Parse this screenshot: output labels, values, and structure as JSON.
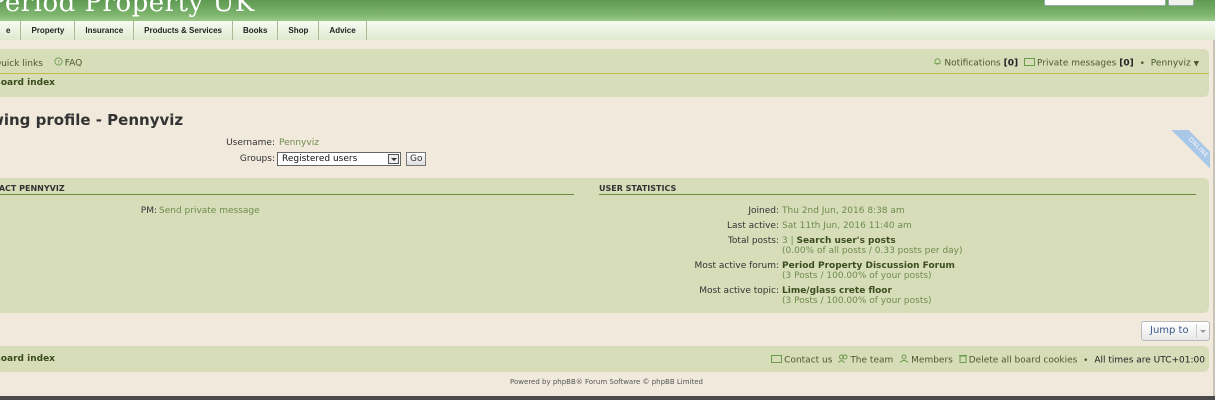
{
  "site": {
    "title": "Period Property UK"
  },
  "nav": [
    "e",
    "Property",
    "Insurance",
    "Products & Services",
    "Books",
    "Shop",
    "Advice"
  ],
  "quick_links": {
    "quick_links": "Quick links",
    "faq": "FAQ"
  },
  "user_bar": {
    "notifications_label": "Notifications",
    "notifications_count": "[0]",
    "pm_label": "Private messages",
    "pm_count": "[0]",
    "bullet": "•",
    "username": "Pennyviz"
  },
  "breadcrumb": "Board index",
  "page_title": "wing profile - Pennyviz",
  "profile": {
    "username_label": "Username:",
    "username_value": "Pennyviz",
    "groups_label": "Groups:",
    "groups_selected": "Registered users",
    "go_label": "Go",
    "online_ribbon": "ONLINE"
  },
  "contact": {
    "title": "TACT PENNYVIZ",
    "pm_label": "PM:",
    "pm_link": "Send private message"
  },
  "stats": {
    "title": "USER STATISTICS",
    "joined_label": "Joined:",
    "joined_value": "Thu 2nd Jun, 2016 8:38 am",
    "last_active_label": "Last active:",
    "last_active_value": "Sat 11th Jun, 2016 11:40 am",
    "total_posts_label": "Total posts:",
    "total_posts_value": "3",
    "total_posts_sep": "|",
    "search_posts": "Search user's posts",
    "total_posts_sub": "(0.00% of all posts / 0.33 posts per day)",
    "most_active_forum_label": "Most active forum:",
    "most_active_forum_value": "Period Property Discussion Forum",
    "most_active_forum_sub": "(3 Posts / 100.00% of your posts)",
    "most_active_topic_label": "Most active topic:",
    "most_active_topic_value": "Lime/glass crete floor",
    "most_active_topic_sub": "(3 Posts / 100.00% of your posts)"
  },
  "jump_to": "Jump to",
  "footer": {
    "board_index": "Board index",
    "contact": "Contact us",
    "team": "The team",
    "members": "Members",
    "delete_cookies": "Delete all board cookies",
    "bullet": "•",
    "timezone": "All times are UTC+01:00",
    "powered": "Powered by phpBB® Forum Software © phpBB Limited"
  }
}
